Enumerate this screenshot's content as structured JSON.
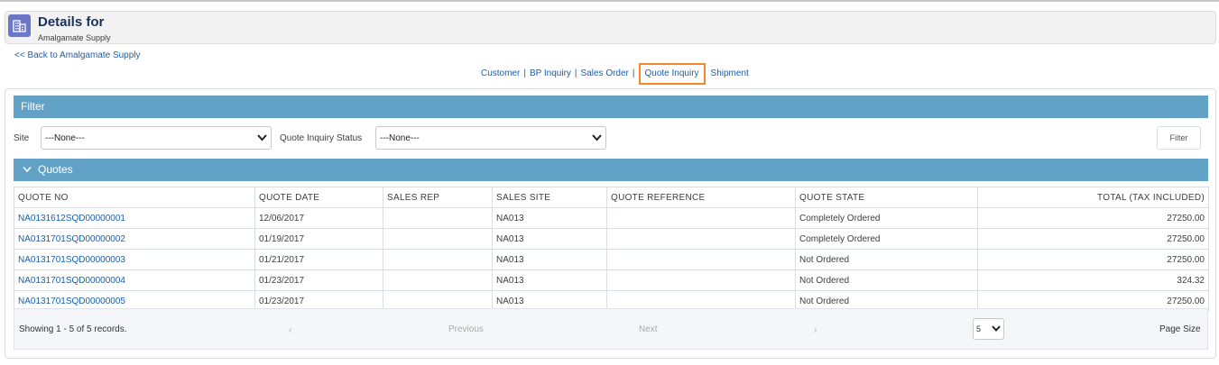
{
  "header": {
    "title": "Details for",
    "subtitle": "Amalgamate Supply",
    "icon": "building-icon",
    "icon_bg": "#6d77c9"
  },
  "back_link": "<< Back to Amalgamate Supply",
  "nav": {
    "customer": "Customer",
    "bp_inquiry": "BP Inquiry",
    "sales_order": "Sales Order",
    "quote_inquiry": "Quote Inquiry",
    "shipment": "Shipment",
    "separator": "|",
    "active_color": "#f2872b"
  },
  "filter": {
    "title": "Filter",
    "site_label": "Site",
    "site_value": "---None---",
    "status_label": "Quote Inquiry Status",
    "status_value": "---None---",
    "button": "Filter"
  },
  "quotes": {
    "title": "Quotes",
    "columns": [
      "QUOTE NO",
      "QUOTE DATE",
      "SALES REP",
      "SALES SITE",
      "QUOTE REFERENCE",
      "QUOTE STATE",
      "TOTAL (TAX INCLUDED)"
    ],
    "rows": [
      {
        "quote_no": "NA0131612SQD00000001",
        "date": "12/06/2017",
        "rep": "",
        "site": "NA013",
        "ref": "",
        "state": "Completely Ordered",
        "total": "27250.00"
      },
      {
        "quote_no": "NA0131701SQD00000002",
        "date": "01/19/2017",
        "rep": "",
        "site": "NA013",
        "ref": "",
        "state": "Completely Ordered",
        "total": "27250.00"
      },
      {
        "quote_no": "NA0131701SQD00000003",
        "date": "01/21/2017",
        "rep": "",
        "site": "NA013",
        "ref": "",
        "state": "Not Ordered",
        "total": "27250.00"
      },
      {
        "quote_no": "NA0131701SQD00000004",
        "date": "01/23/2017",
        "rep": "",
        "site": "NA013",
        "ref": "",
        "state": "Not Ordered",
        "total": "324.32"
      },
      {
        "quote_no": "NA0131701SQD00000005",
        "date": "01/23/2017",
        "rep": "",
        "site": "NA013",
        "ref": "",
        "state": "Not Ordered",
        "total": "27250.00"
      }
    ]
  },
  "pagination": {
    "info": "Showing 1 - 5 of 5 records.",
    "prev_icon": "‹",
    "previous": "Previous",
    "next": "Next",
    "next_icon": "›",
    "page_size_value": "5",
    "page_size_label": "Page Size"
  },
  "colors": {
    "section_bar": "#62a2c6",
    "link": "#1a5fa8"
  }
}
